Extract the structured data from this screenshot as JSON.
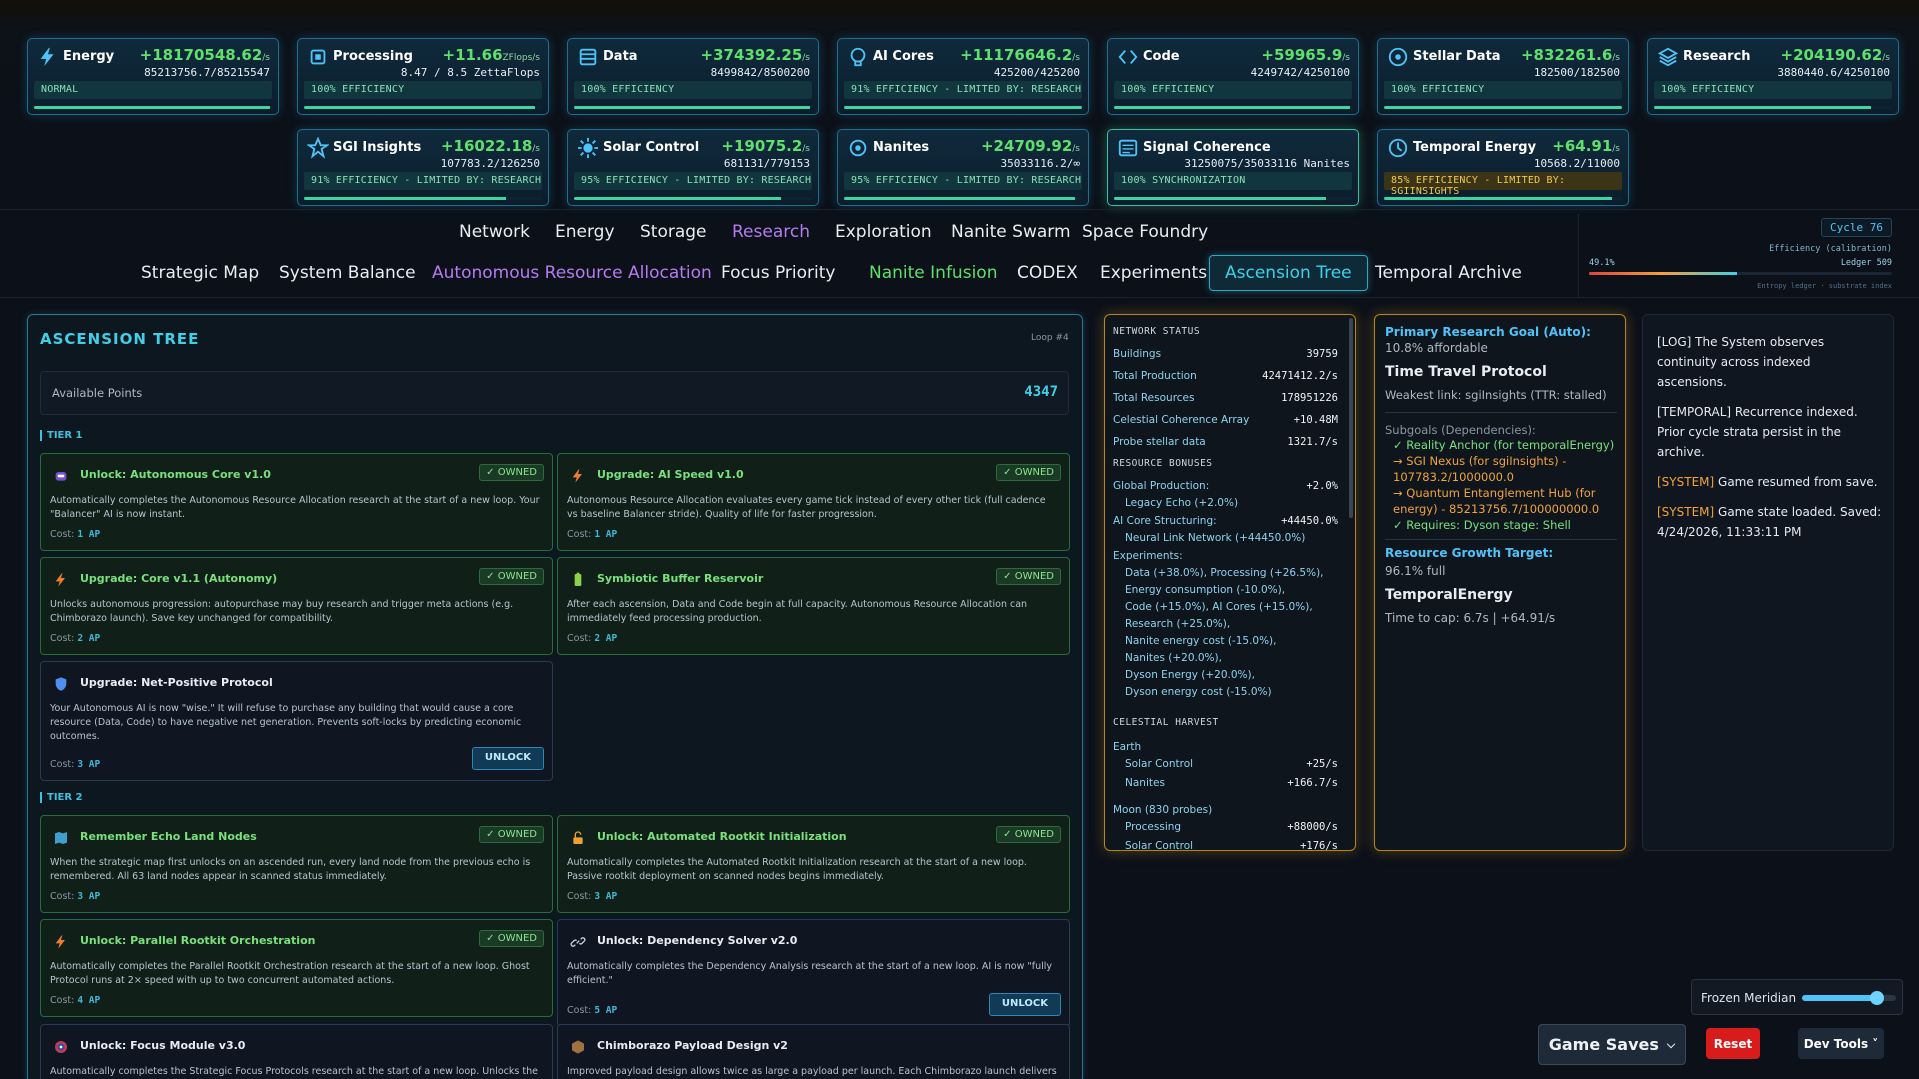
{
  "resources_row1": [
    {
      "name": "Energy",
      "rate": "+18170548.62",
      "unit": "/s",
      "amount": "85213756.7/85215547",
      "eff": "NORMAL",
      "eff_style": "normal",
      "fill": 0.99,
      "icon": "lightning-icon"
    },
    {
      "name": "Processing",
      "rate": "+11.66",
      "unit": "ZFlops/s",
      "amount": "8.47 / 8.5 ZettaFlops",
      "eff": "100% EFFICIENCY",
      "eff_style": "normal",
      "fill": 0.97,
      "icon": "cpu-icon"
    },
    {
      "name": "Data",
      "rate": "+374392.25",
      "unit": "/s",
      "amount": "8499842/8500200",
      "eff": "100% EFFICIENCY",
      "eff_style": "normal",
      "fill": 0.99,
      "icon": "database-icon"
    },
    {
      "name": "AI Cores",
      "rate": "+11176646.2",
      "unit": "/s",
      "amount": "425200/425200",
      "eff": "91% EFFICIENCY - LIMITED BY: RESEARCH",
      "eff_style": "normal",
      "fill": 1.0,
      "icon": "brain-icon"
    },
    {
      "name": "Code",
      "rate": "+59965.9",
      "unit": "/s",
      "amount": "4249742/4250100",
      "eff": "100% EFFICIENCY",
      "eff_style": "normal",
      "fill": 0.99,
      "icon": "code-icon"
    },
    {
      "name": "Stellar Data",
      "rate": "+832261.6",
      "unit": "/s",
      "amount": "182500/182500",
      "eff": "100% EFFICIENCY",
      "eff_style": "normal",
      "fill": 1.0,
      "icon": "star-gauge-icon"
    },
    {
      "name": "Research",
      "rate": "+204190.62",
      "unit": "/s",
      "amount": "3880440.6/4250100",
      "eff": "100% EFFICIENCY",
      "eff_style": "normal",
      "fill": 0.91,
      "icon": "layers-icon"
    }
  ],
  "resources_row2": [
    {
      "name": "SGI Insights",
      "rate": "+16022.18",
      "unit": "/s",
      "amount": "107783.2/126250",
      "eff": "91% EFFICIENCY - LIMITED BY: RESEARCH",
      "eff_style": "normal",
      "fill": 0.85,
      "icon": "star-icon"
    },
    {
      "name": "Solar Control",
      "rate": "+19075.2",
      "unit": "/s",
      "amount": "681131/779153",
      "eff": "95% EFFICIENCY - LIMITED BY: RESEARCH",
      "eff_style": "normal",
      "fill": 0.87,
      "icon": "sun-icon"
    },
    {
      "name": "Nanites",
      "rate": "+24709.92",
      "unit": "/s",
      "amount": "35033116.2/∞",
      "eff": "95% EFFICIENCY - LIMITED BY: RESEARCH",
      "eff_style": "normal",
      "fill": 0.97,
      "icon": "nanite-icon"
    },
    {
      "name": "Signal Coherence",
      "rate": "",
      "unit": "",
      "amount": "31250075/35033116 Nanites",
      "eff": "100% SYNCHRONIZATION",
      "eff_style": "normal",
      "fill": 0.89,
      "icon": "signal-icon"
    },
    {
      "name": "Temporal Energy",
      "rate": "+64.91",
      "unit": "/s",
      "amount": "10568.2/11000",
      "eff": "85% EFFICIENCY - LIMITED BY: SGIINSIGHTS",
      "eff_style": "gold",
      "fill": 0.96,
      "icon": "clock-icon"
    }
  ],
  "nav_main": [
    "Network",
    "Energy",
    "Storage",
    "Research",
    "Exploration",
    "Nanite Swarm",
    "Space Foundry"
  ],
  "nav_sub": [
    "Strategic Map",
    "System Balance",
    "Autonomous Resource Allocation",
    "Focus Priority",
    "Nanite Infusion",
    "CODEX",
    "Experiments",
    "Ascension Tree",
    "Temporal Archive"
  ],
  "calibration": {
    "cycle": "Cycle 76",
    "label": "Efficiency (calibration)",
    "pct": "49.1%",
    "ledger": "Ledger 509",
    "caption": "Entropy ledger · substrate index",
    "fill": 0.49
  },
  "ascension": {
    "title": "ASCENSION TREE",
    "loop": "Loop #4",
    "points_label": "Available Points",
    "points": "4347",
    "tier1": "TIER 1",
    "tier2": "TIER 2",
    "owned": "✓ OWNED",
    "unlock": "UNLOCK",
    "cost_prefix": "Cost:",
    "nodes": [
      {
        "title": "Unlock: Autonomous Core v1.0",
        "desc": "Automatically completes the Autonomous Resource Allocation research at the start of a new loop. Your \"Balancer\" AI is now instant.",
        "cost": "1 AP",
        "owned": true,
        "icon": "robot-icon"
      },
      {
        "title": "Upgrade: AI Speed v1.0",
        "desc": "Autonomous Resource Allocation evaluates every game tick instead of every other tick (full cadence vs baseline Balancer stride). Quality of life for faster progression.",
        "cost": "1 AP",
        "owned": true,
        "icon": "lightning-icon"
      },
      {
        "title": "Upgrade: Core v1.1 (Autonomy)",
        "desc": "Unlocks autonomous progression: autopurchase may buy research and trigger meta actions (e.g. Chimborazo launch). Save key unchanged for compatibility.",
        "cost": "2 AP",
        "owned": true,
        "icon": "lightning-icon"
      },
      {
        "title": "Symbiotic Buffer Reservoir",
        "desc": "After each ascension, Data and Code begin at full capacity. Autonomous Resource Allocation can immediately feed processing production.",
        "cost": "2 AP",
        "owned": true,
        "icon": "battery-icon"
      },
      {
        "title": "Upgrade: Net-Positive Protocol",
        "desc": "Your Autonomous AI is now \"wise.\" It will refuse to purchase any building that would cause a core resource (Data, Code) to have negative net generation. Prevents soft-locks by predicting economic outcomes.",
        "cost": "3 AP",
        "owned": false,
        "icon": "shield-icon"
      },
      {
        "title": "Remember Echo Land Nodes",
        "desc": "When the strategic map first unlocks on an ascended run, every land node from the previous echo is remembered. All 63 land nodes appear in scanned status immediately.",
        "cost": "3 AP",
        "owned": true,
        "icon": "map-icon"
      },
      {
        "title": "Unlock: Automated Rootkit Initialization",
        "desc": "Automatically completes the Automated Rootkit Initialization research at the start of a new loop. Passive rootkit deployment on scanned nodes begins immediately.",
        "cost": "3 AP",
        "owned": true,
        "icon": "unlock-icon"
      },
      {
        "title": "Unlock: Parallel Rootkit Orchestration",
        "desc": "Automatically completes the Parallel Rootkit Orchestration research at the start of a new loop. Ghost Protocol runs at 2× speed with up to two concurrent automated actions.",
        "cost": "4 AP",
        "owned": true,
        "icon": "lightning-icon"
      },
      {
        "title": "Unlock: Dependency Solver v2.0",
        "desc": "Automatically completes the Dependency Analysis research at the start of a new loop. AI is now \"fully efficient.\"",
        "cost": "5 AP",
        "owned": false,
        "icon": "link-icon"
      },
      {
        "title": "Unlock: Focus Module v3.0",
        "desc": "Automatically completes the Strategic Focus Protocols research at the start of a new loop. Unlocks the",
        "cost": "",
        "owned": false,
        "icon": "target-icon"
      },
      {
        "title": "Chimborazo Payload Design v2",
        "desc": "Improved payload design allows twice as large a payload per launch. Each Chimborazo launch delivers",
        "cost": "",
        "owned": false,
        "icon": "cube-icon"
      }
    ]
  },
  "network": {
    "title": "NETWORK STATUS",
    "rows": [
      [
        "Buildings",
        "39759"
      ],
      [
        "Total Production",
        "42471412.2/s"
      ],
      [
        "Total Resources",
        "178951226"
      ],
      [
        "Celestial Coherence Array",
        "+10.48M"
      ],
      [
        "Probe stellar data",
        "1321.7/s"
      ]
    ],
    "bonus_title": "RESOURCE BONUSES",
    "global_label": "Global Production:",
    "global_val": "+2.0%",
    "legacy": "Legacy Echo (+2.0%)",
    "aicore_label": "AI Core Structuring:",
    "aicore_val": "+44450.0%",
    "neural": "Neural Link Network (+44450.0%)",
    "exp_label": "Experiments:",
    "exp_lines": [
      "Data (+38.0%), Processing (+26.5%),",
      "Energy consumption (-10.0%),",
      "Code (+15.0%), AI Cores (+15.0%),",
      "Research (+25.0%),",
      "Nanite energy cost (-15.0%),",
      "Nanites (+20.0%),",
      "Dyson Energy (+20.0%),",
      "Dyson energy cost (-15.0%)"
    ],
    "harvest_title": "CELESTIAL HARVEST",
    "earth": "Earth",
    "earth_rows": [
      [
        "Solar Control",
        "+25/s"
      ],
      [
        "Nanites",
        "+166.7/s"
      ]
    ],
    "moon": "Moon (830 probes)",
    "moon_rows": [
      [
        "Processing",
        "+88000/s"
      ],
      [
        "Solar Control",
        "+176/s"
      ]
    ]
  },
  "goals": {
    "primary_label": "Primary Research Goal (Auto):",
    "affordable": "10.8% affordable",
    "goal": "Time Travel Protocol",
    "weakest": "Weakest link: sgiInsights (TTR: stalled)",
    "subgoals_label": "Subgoals (Dependencies):",
    "subgoals": [
      {
        "text": "✓ Reality Anchor (for temporalEnergy)",
        "state": "done"
      },
      {
        "text": "→ SGI Nexus (for sgiInsights) - 107783.2/1000000.0",
        "state": "todo"
      },
      {
        "text": "→ Quantum Entanglement Hub (for energy) - 85213756.7/100000000.0",
        "state": "todo"
      },
      {
        "text": "✓ Requires: Dyson stage: Shell",
        "state": "done"
      }
    ],
    "growth_label": "Resource Growth Target:",
    "growth_full": "96.1% full",
    "growth_res": "TemporalEnergy",
    "growth_time": "Time to cap: 6.7s | +64.91/s"
  },
  "log": [
    {
      "tag": "",
      "text": "[LOG] The System observes continuity across indexed ascensions."
    },
    {
      "tag": "",
      "text": "[TEMPORAL] Recurrence indexed. Prior cycle strata persist in the archive."
    },
    {
      "tag": "[SYSTEM]",
      "text": " Game resumed from save."
    },
    {
      "tag": "[SYSTEM]",
      "text": " Game state loaded. Saved: 4/24/2026, 11:33:11 PM"
    }
  ],
  "footer": {
    "meridian": "Frozen Meridian",
    "meridian_level": 0.8,
    "saves": "Game Saves",
    "reset": "Reset",
    "dev": "Dev Tools ˅"
  },
  "colors": {
    "accent": "#3fd0e8",
    "owned": "#79e07c",
    "research_nav": "#b57cf0",
    "gold": "#f3c94c",
    "reset": "#d81b1b"
  }
}
